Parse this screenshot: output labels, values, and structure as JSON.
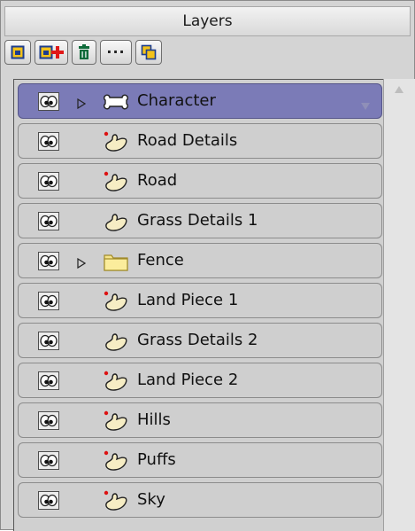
{
  "panel": {
    "title": "Layers"
  },
  "toolbar": {
    "buttons": [
      {
        "name": "new-layer-button",
        "icon": "new-layer-icon"
      },
      {
        "name": "add-layer-button",
        "icon": "add-layer-icon"
      },
      {
        "name": "delete-layer-button",
        "icon": "trash-icon"
      },
      {
        "name": "more-options-button",
        "icon": "ellipsis-icon",
        "label": "···"
      },
      {
        "name": "duplicate-layer-button",
        "icon": "duplicate-icon"
      }
    ]
  },
  "layers": [
    {
      "name": "Character",
      "type": "bone",
      "expandable": true,
      "selected": true,
      "marker": false
    },
    {
      "name": "Road Details",
      "type": "vector",
      "expandable": false,
      "selected": false,
      "marker": true
    },
    {
      "name": "Road",
      "type": "vector",
      "expandable": false,
      "selected": false,
      "marker": true
    },
    {
      "name": "Grass Details 1",
      "type": "vector",
      "expandable": false,
      "selected": false,
      "marker": false
    },
    {
      "name": "Fence",
      "type": "group",
      "expandable": true,
      "selected": false,
      "marker": false
    },
    {
      "name": "Land Piece 1",
      "type": "vector",
      "expandable": false,
      "selected": false,
      "marker": true
    },
    {
      "name": "Grass Details 2",
      "type": "vector",
      "expandable": false,
      "selected": false,
      "marker": false
    },
    {
      "name": "Land Piece 2",
      "type": "vector",
      "expandable": false,
      "selected": false,
      "marker": true
    },
    {
      "name": "Hills",
      "type": "vector",
      "expandable": false,
      "selected": false,
      "marker": true
    },
    {
      "name": "Puffs",
      "type": "vector",
      "expandable": false,
      "selected": false,
      "marker": true
    },
    {
      "name": "Sky",
      "type": "vector",
      "expandable": false,
      "selected": false,
      "marker": true
    }
  ],
  "colors": {
    "selected_row": "#7b7bb7",
    "row": "#cfcfcf",
    "panel": "#d4d4d4",
    "marker": "#dd1111",
    "folder": "#f6e48a",
    "vector_fill": "#f6edc4"
  }
}
